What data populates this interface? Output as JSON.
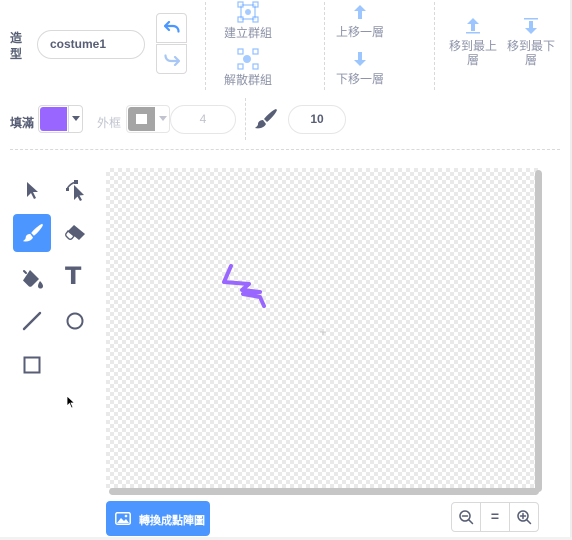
{
  "costume": {
    "label": "造型",
    "name": "costume1"
  },
  "history": {
    "undo_icon": "undo-icon",
    "redo_icon": "redo-icon"
  },
  "group_actions": {
    "group_label": "建立群組",
    "ungroup_label": "解散群組"
  },
  "layer_actions": {
    "forward_label": "上移一層",
    "backward_label": "下移一層",
    "front_label": "移到最上層",
    "back_label": "移到最下層"
  },
  "fill": {
    "label": "填滿",
    "color": "#9966ff"
  },
  "outline": {
    "label": "外框",
    "width": "4"
  },
  "brush": {
    "size": "10"
  },
  "tools": [
    {
      "name": "select",
      "icon": "select-arrow-icon",
      "selected": false
    },
    {
      "name": "reshape",
      "icon": "reshape-icon",
      "selected": false
    },
    {
      "name": "brush",
      "icon": "brush-icon",
      "selected": true
    },
    {
      "name": "eraser",
      "icon": "eraser-icon",
      "selected": false
    },
    {
      "name": "fill",
      "icon": "paint-bucket-icon",
      "selected": false
    },
    {
      "name": "text",
      "icon": "text-icon",
      "selected": false
    },
    {
      "name": "line",
      "icon": "line-icon",
      "selected": false
    },
    {
      "name": "circle",
      "icon": "circle-icon",
      "selected": false
    },
    {
      "name": "rectangle",
      "icon": "rectangle-icon",
      "selected": false
    }
  ],
  "text_tool": {
    "glyph": "T"
  },
  "convert": {
    "label": "轉換成點陣圖"
  },
  "zoom": {
    "zoom_out_icon": "zoom-out-icon",
    "reset_label": "=",
    "zoom_in_icon": "zoom-in-icon"
  },
  "colors": {
    "accent": "#4c97ff",
    "fill": "#9966ff",
    "stroke_drawn": "#9966ff",
    "outline_swatch": "#a5a5a5"
  }
}
